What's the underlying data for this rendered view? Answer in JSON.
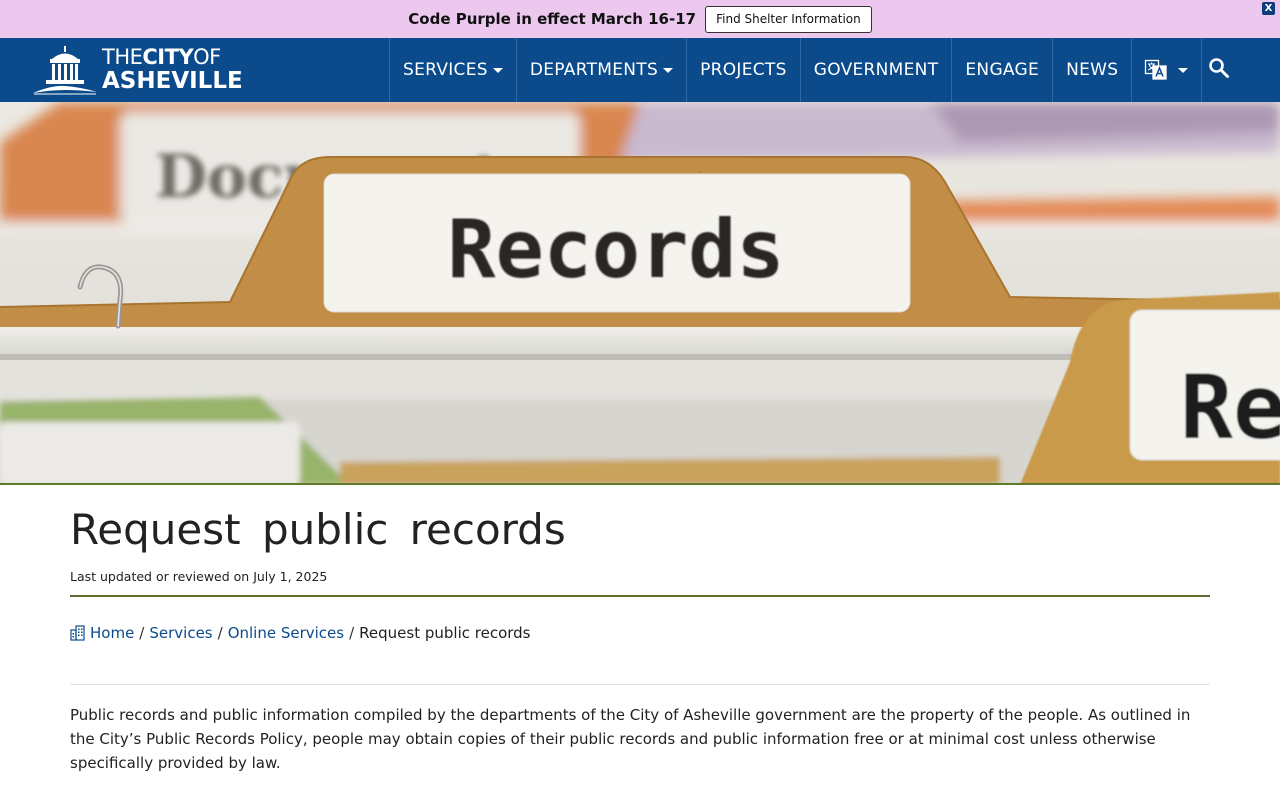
{
  "alert": {
    "text": "Code Purple in effect March 16-17",
    "button_label": "Find Shelter Information",
    "close_label": "X"
  },
  "logo": {
    "line1_the": "THE",
    "line1_city": "CITY",
    "line1_of": "OF",
    "line2": "ASHEVILLE"
  },
  "nav": {
    "items": [
      {
        "label": "SERVICES",
        "has_dropdown": true
      },
      {
        "label": "DEPARTMENTS",
        "has_dropdown": true
      },
      {
        "label": "PROJECTS",
        "has_dropdown": false
      },
      {
        "label": "GOVERNMENT",
        "has_dropdown": false
      },
      {
        "label": "ENGAGE",
        "has_dropdown": false
      },
      {
        "label": "NEWS",
        "has_dropdown": false
      }
    ],
    "language_icon": "translate-icon",
    "search_icon": "search-icon"
  },
  "hero": {
    "tab_main": "Records",
    "tab_back": "Documents",
    "tab_right": "Re"
  },
  "page": {
    "title": "Request public records",
    "updated": "Last updated or reviewed on July 1, 2025"
  },
  "breadcrumb": {
    "home": "Home",
    "services": "Services",
    "online_services": "Online Services",
    "current": "Request public records",
    "separator": "/"
  },
  "body": {
    "paragraph": "Public records and public information compiled by the departments of the City of Asheville government are the property of the people. As outlined in the City’s Public Records Policy, people may obtain copies of their public records and public information free or at minimal cost unless otherwise specifically provided by law."
  },
  "colors": {
    "nav_bg": "#0b4b8c",
    "alert_bg": "#ecc8ef",
    "link": "#0b4b8c",
    "accent_rule": "#5f6e2c"
  }
}
